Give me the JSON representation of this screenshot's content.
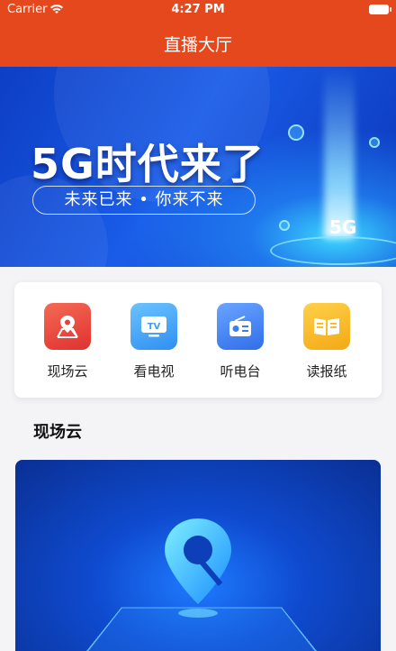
{
  "status_bar": {
    "carrier": "Carrier",
    "time": "4:27 PM"
  },
  "header": {
    "title": "直播大厅"
  },
  "banner": {
    "headline": "5G时代来了",
    "tagline": "未来已来 • 你来不来",
    "badge": "5G"
  },
  "menu": [
    {
      "label": "现场云",
      "icon": "location-map-icon",
      "color": "#e8403c"
    },
    {
      "label": "看电视",
      "icon": "tv-icon",
      "color": "#3a9ef5"
    },
    {
      "label": "听电台",
      "icon": "radio-icon",
      "color": "#3c7ef0"
    },
    {
      "label": "读报纸",
      "icon": "newspaper-icon",
      "color": "#f6b521"
    }
  ],
  "section": {
    "title": "现场云"
  },
  "colors": {
    "header": "#e5481c",
    "background": "#f4f4f6"
  }
}
